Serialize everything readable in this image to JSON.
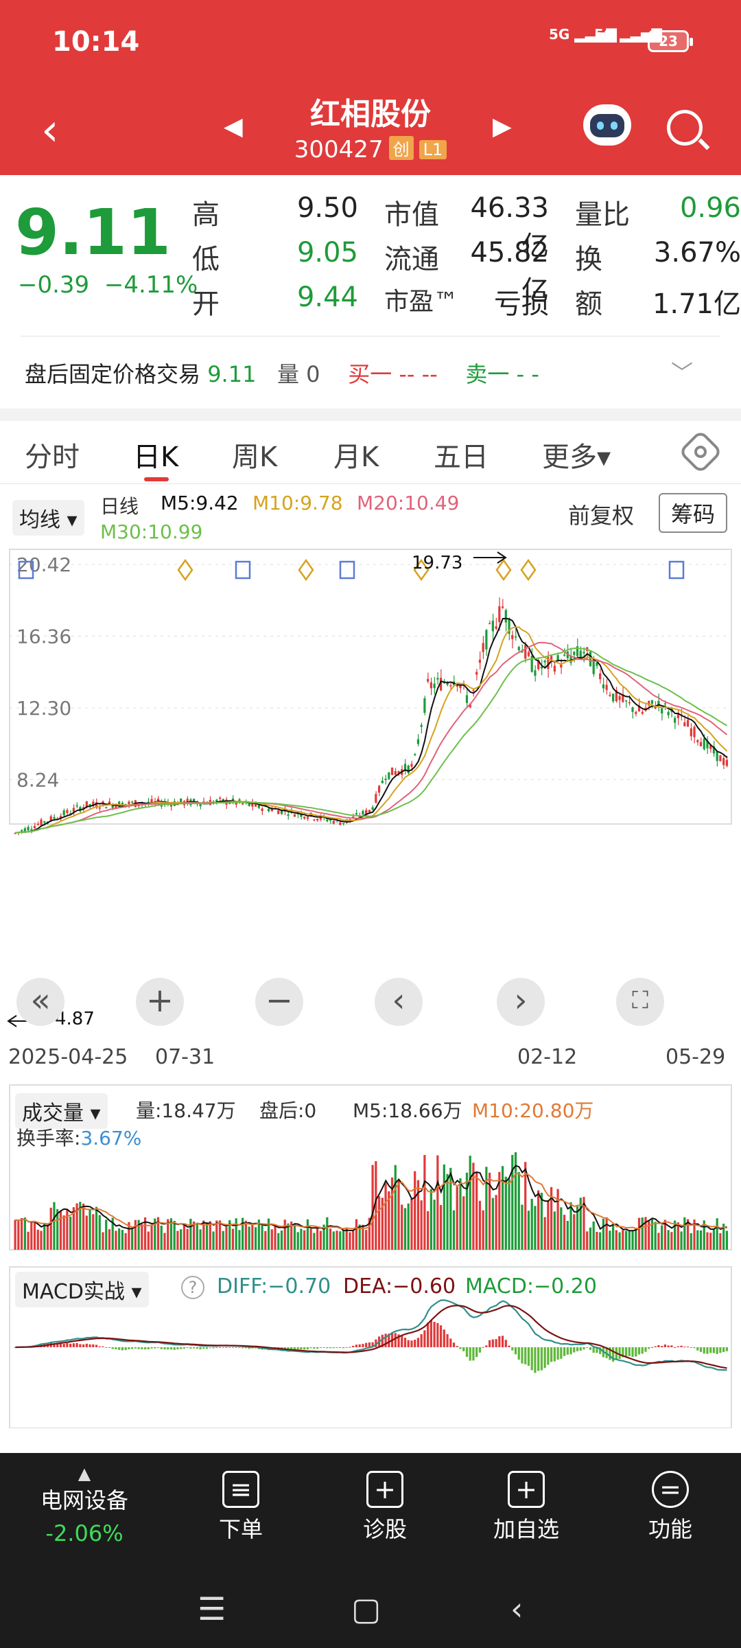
{
  "status": {
    "time": "10:14",
    "signal1": "5G",
    "signal2": "5G",
    "battery": "23"
  },
  "header": {
    "name": "红相股份",
    "code": "300427",
    "badge1": "创",
    "badge2": "L1"
  },
  "quote": {
    "price": "9.11",
    "change": "−0.39",
    "change_pct": "−4.11%",
    "high_label": "高",
    "high": "9.50",
    "low_label": "低",
    "low": "9.05",
    "open_label": "开",
    "open": "9.44",
    "mktcap_label": "市值",
    "mktcap": "46.33亿",
    "float_label": "流通",
    "float": "45.82亿",
    "pe_label": "市盈™",
    "pe": "亏损",
    "volratio_label": "量比",
    "volratio": "0.96",
    "turnover_label": "换",
    "turnover": "3.67%",
    "amount_label": "额",
    "amount": "1.71亿"
  },
  "afterhours": {
    "label": "盘后固定价格交易",
    "price": "9.11",
    "vol_label": "量",
    "vol": "0",
    "buy_label": "买一",
    "buy": "-- --",
    "sell_label": "卖一",
    "sell": "- -"
  },
  "tabs": [
    "分时",
    "日K",
    "周K",
    "月K",
    "五日",
    "更多▾"
  ],
  "kline": {
    "ma_button": "均线 ▾",
    "period": "日线",
    "m5": "M5:9.42",
    "m10": "M10:9.78",
    "m20": "M20:10.49",
    "m30": "M30:10.99",
    "adjust": "前复权",
    "chips": "筹码",
    "y_labels": [
      "20.42",
      "16.36",
      "12.30",
      "8.24"
    ],
    "max_label": "19.73",
    "min_label": "4.87",
    "dates": [
      "2025-04-25",
      "07-31",
      "02-12",
      "05-29"
    ],
    "colors": {
      "ma5": "#111111",
      "ma10": "#d6a21e",
      "ma20": "#e0637a",
      "ma30": "#6cbf4a"
    }
  },
  "volume": {
    "label": "成交量 ▾",
    "vol": "量:18.47万",
    "after": "盘后:0",
    "m5": "M5:18.66万",
    "m10": "M10:20.80万",
    "turn_label": "换手率:",
    "turn": "3.67%"
  },
  "macd": {
    "label": "MACD实战 ▾",
    "help": "?",
    "diff": "DIFF:−0.70",
    "dea": "DEA:−0.60",
    "macd": "MACD:−0.20"
  },
  "bottom": {
    "sector": "电网设备",
    "sector_chg": "-2.06%",
    "order": "下单",
    "diagnose": "诊股",
    "watch": "加自选",
    "func": "功能"
  }
}
